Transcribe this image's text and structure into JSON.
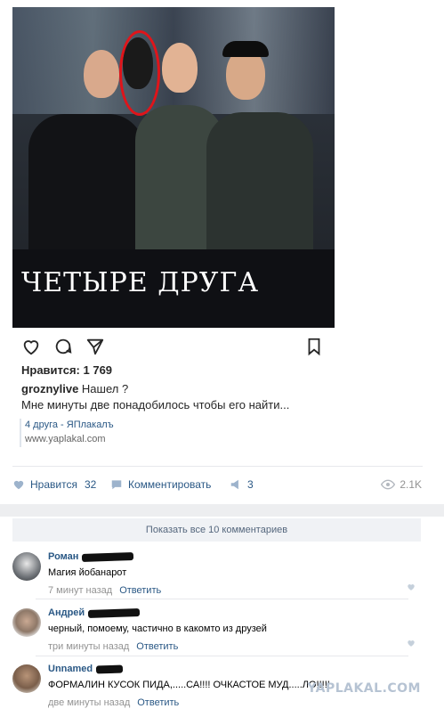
{
  "post": {
    "caption": "ЧЕТЫРЕ ДРУГА",
    "likes_text": "Нравится: 1 769",
    "author": "groznylive",
    "author_text": "Нашел ?",
    "body_text": "Мне минуты две понадобилось чтобы его найти...",
    "link_title": "4 друга - ЯПлакалъ",
    "link_url": "www.yaplakal.com"
  },
  "icons": [
    "heart-icon",
    "comment-bubble-icon",
    "send-icon",
    "bookmark-icon",
    "like-icon",
    "comment-icon",
    "share-icon",
    "eye-icon"
  ],
  "toolbar": {
    "like_label": "Нравится",
    "like_count": "32",
    "comment_label": "Комментировать",
    "share_count": "3",
    "views": "2.1K"
  },
  "comments_section": {
    "show_all": "Показать все 10 комментариев",
    "items": [
      {
        "author": "Роман",
        "text": "Магия йобанарот",
        "time": "7 минут назад",
        "reply": "Ответить"
      },
      {
        "author": "Андрей",
        "text": "черный, помоему, частично в какомто из друзей",
        "time": "три минуты назад",
        "reply": "Ответить"
      },
      {
        "author": "Unnamed",
        "text": "ФОРМАЛИН КУСОК ПИДА,.....СА!!!! ОЧКАСТОЕ МУД.....ЛО!!!!!",
        "time": "две минуты назад",
        "reply": "Ответить"
      }
    ]
  },
  "watermark": "YAPLAKAL.COM",
  "colors": {
    "link": "#2a5885",
    "muted": "#939393",
    "highlight_ellipse": "#e0141a"
  }
}
